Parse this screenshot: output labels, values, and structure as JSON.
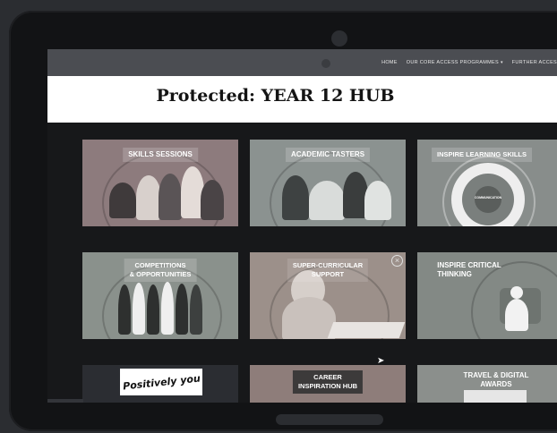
{
  "nav": {
    "items": [
      "HOME",
      "OUR CORE ACCESS PROGRAMMES",
      "FURTHER ACCES"
    ]
  },
  "page": {
    "title": "Protected: YEAR 12 HUB"
  },
  "tiles": [
    {
      "label": "SKILLS SESSIONS"
    },
    {
      "label": "ACADEMIC TASTERS"
    },
    {
      "label": "INSPIRE LEARNING SKILLS"
    },
    {
      "label": "COMPETITIONS\n& OPPORTUNITIES"
    },
    {
      "label": "SUPER-CURRICULAR\nSUPPORT"
    },
    {
      "label": "INSPIRE CRITICAL\nTHINKING"
    },
    {
      "label": "Positively you"
    },
    {
      "label": "CAREER\nINSPIRATION HUB"
    },
    {
      "label": "TRAVEL & DIGITAL\nAWARDS"
    }
  ],
  "diagram": {
    "center": "COMMUNICATION"
  },
  "colors": {
    "background": "#2b2d31",
    "bezel": "#121315",
    "navbar": "#4b4d52",
    "tile_rose": "#8f7b7d",
    "tile_sage": "#8a918c",
    "tile_taupe": "#9b8f88"
  },
  "icons": {
    "cursor": "mouse-pointer-icon",
    "close": "close-icon"
  }
}
